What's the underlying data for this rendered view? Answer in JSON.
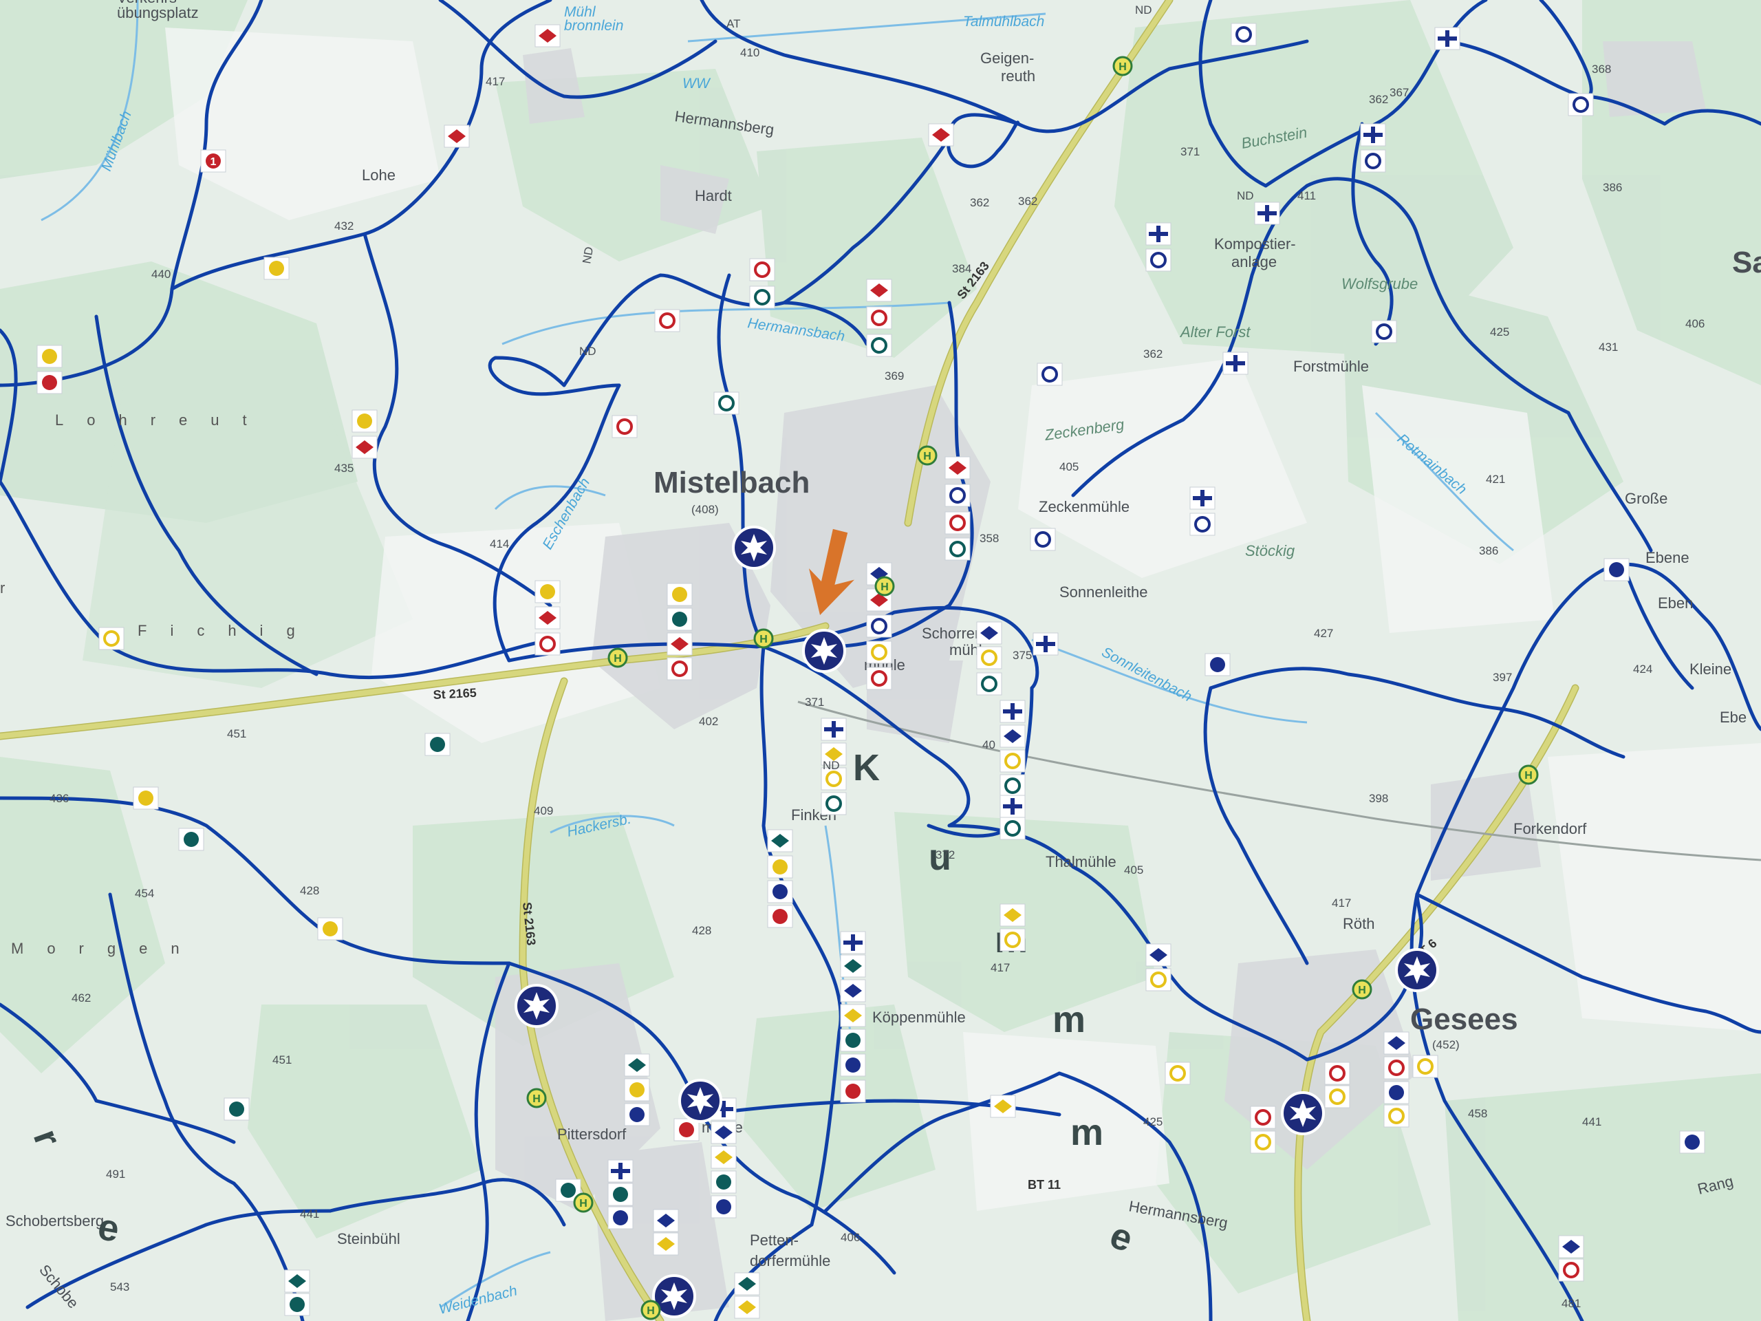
{
  "towns": {
    "mistelbach": "Mistelbach",
    "mistelbach_elev": "(408)",
    "gesees": "Gesees",
    "gesees_elev": "(452)",
    "pittersdorf": "Pittersdorf",
    "forkendorf": "Forkendorf",
    "hardt": "Hardt",
    "lohe": "Lohe",
    "geigenreuth_1": "Geigen-",
    "geigenreuth_2": "reuth",
    "hermannsberg_n": "Hermannsberg",
    "hermannsberg_s": "Hermannsberg",
    "zeckenmuhle": "Zeckenmühle",
    "sonnenleithe": "Sonnenleithe",
    "thalmuhle": "Thalmühle",
    "forstmuhle": "Forstmühle",
    "steinbuhl": "Steinbühl",
    "schobertsberg": "Schobertsberg",
    "pettendorfermuhle_1": "Petten-",
    "pettendorfermuhle_2": "dorfermühle",
    "roth": "Röth",
    "grosse": "Große",
    "ebene": "Ebene",
    "eben": "Eben",
    "kleine": "Kleine",
    "ebe": "Ebe",
    "sa": "Sa",
    "finken": "Finken",
    "schorren_1": "Schorren",
    "schorren_2": "mühle",
    "koppenmuhle": "Köppenmühle",
    "komposti_1": "Kompostier-",
    "komposti_2": "anlage",
    "mistelmuhle": "mühle",
    "ubung_1": "Verkehrs-",
    "ubung_2": "übungsplatz",
    "muhlbronnlein_1": "Mühl",
    "muhlbronnlein_2": "bronnlein",
    "rang": "Rang",
    "schobe": "Schobe",
    "hmuhle": "mühle"
  },
  "fields": {
    "zeckenberg": "Zeckenberg",
    "buchstein": "Buchstein",
    "alter_forst": "Alter Forst",
    "wolfsgrube": "Wolfsgrube",
    "stockig": "Stöckig"
  },
  "waters": {
    "talmuhlbach": "Talmühlbach",
    "hermannsbach": "Hermannsbach",
    "muhlbach": "Mühlbach",
    "eschenbach": "Eschenbach",
    "hackersbach": "Hackersb.",
    "sonnleitenbach": "Sonnleitenbach",
    "rote_main": "Rotmainbach",
    "weidenbach": "Weidenbach"
  },
  "roads": {
    "st2165_a": "St 2165",
    "st2163_a": "St 2163",
    "st2163_b": "St 2163",
    "bt11": "BT 11",
    "bt6": "BT 6"
  },
  "spaced": {
    "lohreut": "Lohreut",
    "fichig": "Fichig",
    "morgen": "Morgen",
    "ichtig": "r"
  },
  "park_letters": [
    "u",
    "m",
    "m",
    "e",
    "m",
    "e",
    "K",
    "r"
  ],
  "elevations": [
    "410",
    "417",
    "432",
    "440",
    "435",
    "414",
    "451",
    "436",
    "454",
    "428",
    "462",
    "451",
    "491",
    "441",
    "543",
    "409",
    "402",
    "371",
    "428",
    "406",
    "417",
    "405",
    "384",
    "369",
    "362",
    "371",
    "362",
    "411",
    "368",
    "386",
    "425",
    "431",
    "406",
    "421",
    "386",
    "427",
    "397",
    "424",
    "398",
    "417",
    "425",
    "458",
    "441",
    "481",
    "405",
    "375",
    "358",
    "372",
    "40",
    "362",
    "367",
    "362"
  ],
  "junction_markers": [
    {
      "symbol": "star",
      "label": "hiking junction"
    }
  ],
  "bus_stop_letter": "H",
  "legend_symbols": {
    "marker_1": "1",
    "nd": "ND",
    "ww": "WW",
    "at": "AT"
  },
  "colors": {
    "trail": "#0f3fa6",
    "background": "#e9f0ea",
    "forest": "#c9e2cf",
    "road": "#d7d77e",
    "arrow": "#d9742a",
    "red": "#c4222a",
    "yellow": "#e6c21a",
    "teal": "#0e5c5a",
    "navy": "#1b2f8a"
  }
}
